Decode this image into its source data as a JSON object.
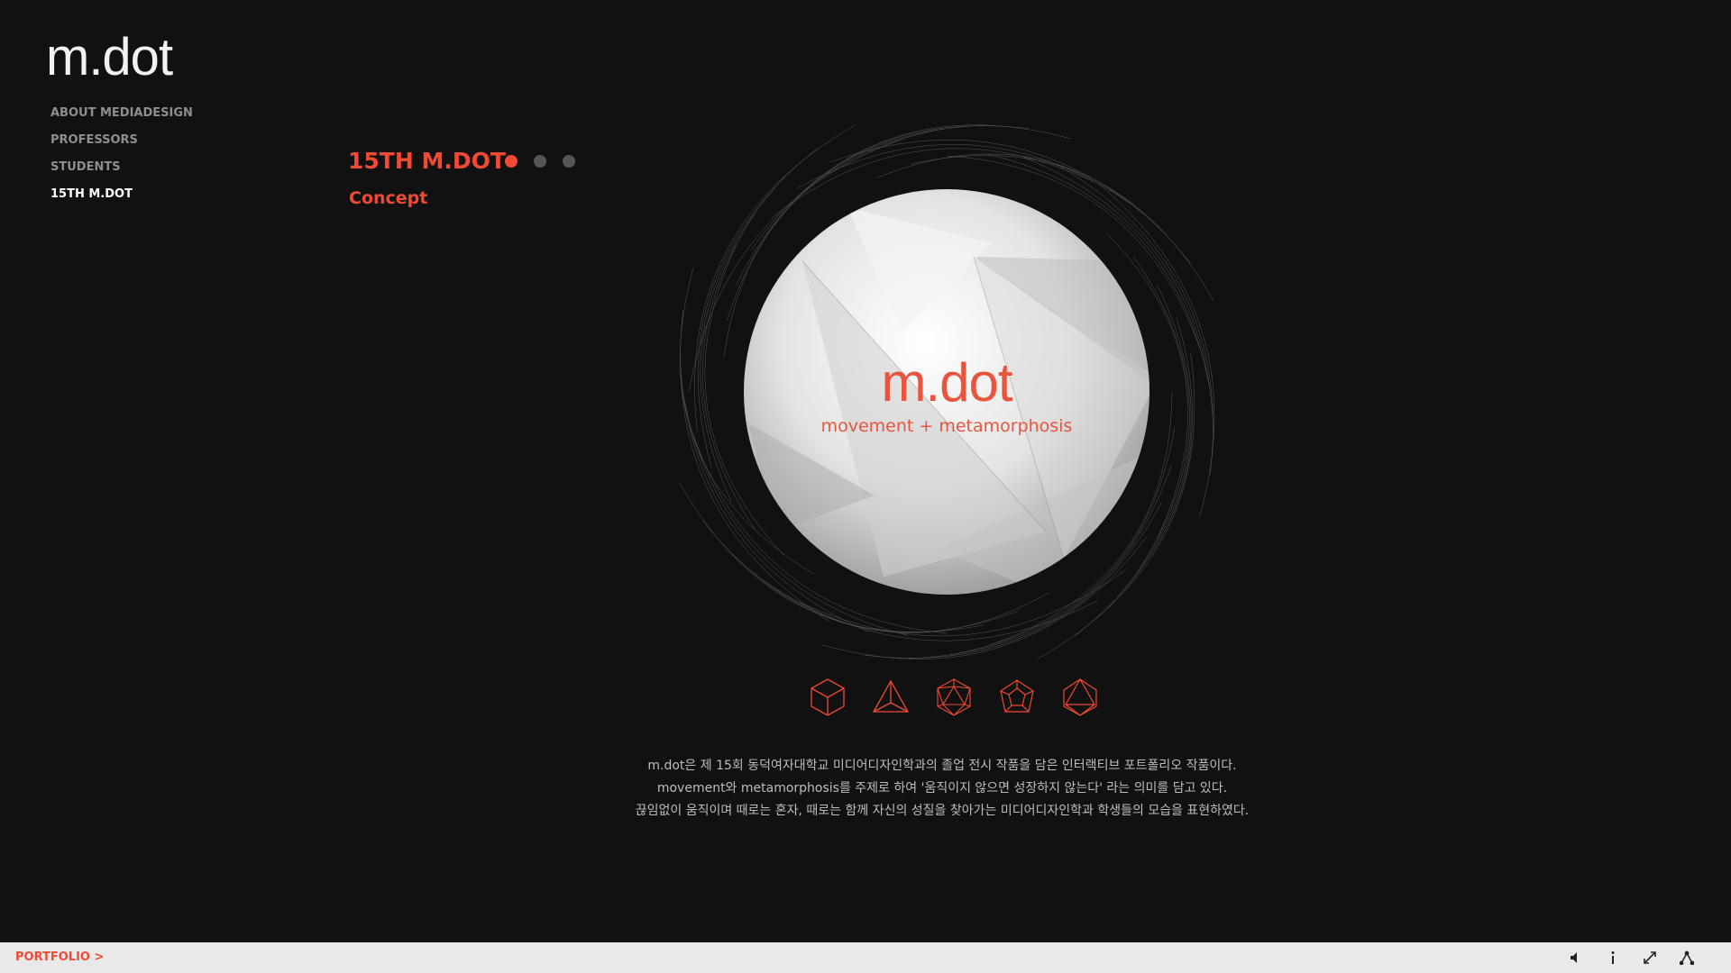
{
  "logo": "m.dot",
  "nav": {
    "items": [
      {
        "label": "ABOUT MEDIADESIGN"
      },
      {
        "label": "PROFESSORS"
      },
      {
        "label": "STUDENTS"
      },
      {
        "label": "15TH M.DOT",
        "active": true
      }
    ]
  },
  "section": {
    "title": "15TH M.DOT",
    "subtitle": "Concept",
    "pager": {
      "total": 3,
      "current": 1
    }
  },
  "hero": {
    "brand": "m.dot",
    "tagline": "movement + metamorphosis"
  },
  "icons": [
    "cube-icon",
    "tetrahedron-icon",
    "icosahedron-icon",
    "dodecahedron-icon",
    "octahedron-icon"
  ],
  "description": {
    "line1": "m.dot은 제 15회 동덕여자대학교 미디어디자인학과의 졸업 전시 작품을 담은 인터랙티브 포트폴리오 작품이다.",
    "line2": "movement와  metamorphosis를 주제로 하여 '움직이지 않으면 성장하지 않는다' 라는 의미를 담고 있다.",
    "line3": "끊임없이 움직이며 때로는 혼자, 때로는 함께 자신의 성질을 찾아가는 미디어디자인학과 학생들의 모습을 표현하였다."
  },
  "bottom": {
    "portfolio": "PORTFOLIO >",
    "controls": [
      "sound-icon",
      "info-icon",
      "fullscreen-icon",
      "share-icon"
    ]
  },
  "colors": {
    "accent": "#ef4a35",
    "background": "#111111",
    "bottombar": "#e9e9e9"
  }
}
